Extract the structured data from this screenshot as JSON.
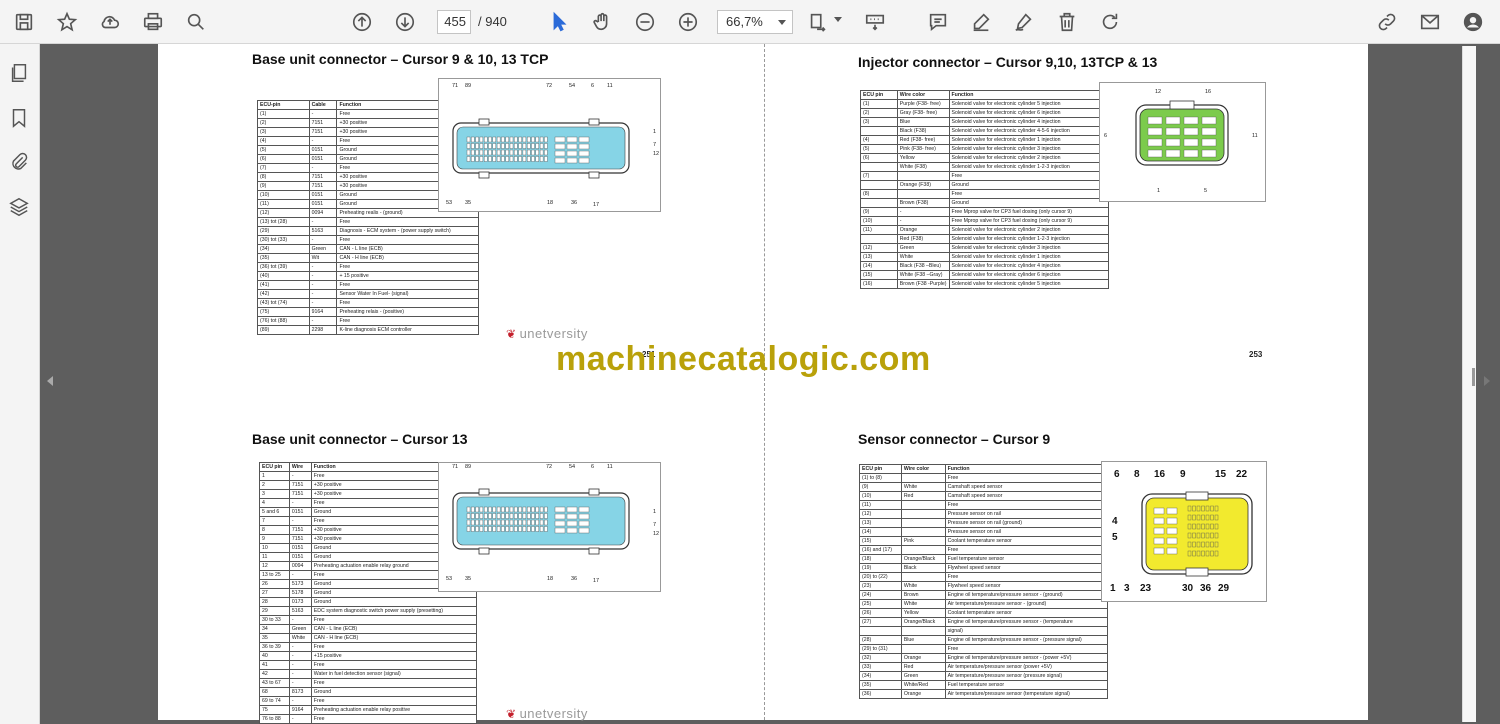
{
  "toolbar": {
    "page_current": "455",
    "page_total": "/ 940",
    "zoom": "66,7%"
  },
  "watermark": "machinecatalogic.com",
  "logo_text": "unetversity",
  "sections": {
    "base_9_10": {
      "title": "Base unit connector – Cursor 9 & 10, 13 TCP",
      "headers": [
        "ECU-pin",
        "Cable",
        "Function"
      ],
      "rows": [
        [
          "(1)",
          "-",
          "Free"
        ],
        [
          "(2)",
          "7151",
          "+30 positive"
        ],
        [
          "(3)",
          "7151",
          "+30 positive"
        ],
        [
          "(4)",
          "-",
          "Free"
        ],
        [
          "(5)",
          "0151",
          "Ground"
        ],
        [
          "(6)",
          "0151",
          "Ground"
        ],
        [
          "(7)",
          "-",
          "Free"
        ],
        [
          "(8)",
          "7151",
          "+30 positive"
        ],
        [
          "(9)",
          "7151",
          "+30 positive"
        ],
        [
          "(10)",
          "0151",
          "Ground"
        ],
        [
          "(11)",
          "0151",
          "Ground"
        ],
        [
          "(12)",
          "0094",
          "Preheating realis - (ground)"
        ],
        [
          "(13) tot (28)",
          "-",
          "Free"
        ],
        [
          "(29)",
          "5163",
          "Diagnosis - ECM system - (power supply switch)"
        ],
        [
          "(30) tot (33)",
          "-",
          "Free"
        ],
        [
          "(34)",
          "Green",
          "CAN - L line (ECB)"
        ],
        [
          "(35)",
          "Wit",
          "CAN - H line (ECB)"
        ],
        [
          "(36) tot (39)",
          "-",
          "Free"
        ],
        [
          "(40)",
          "-",
          "+ 15 positive"
        ],
        [
          "(41)",
          "-",
          "Free"
        ],
        [
          "(42)",
          "-",
          "Sensor Water In Fuel- (signal)"
        ],
        [
          "(43) tot (74)",
          "-",
          "Free"
        ],
        [
          "(75)",
          "9164",
          "Preheating relais - (positive)"
        ],
        [
          "(76) tot (88)",
          "-",
          "Free"
        ],
        [
          "(89)",
          "2298",
          "K-line diagnosis ECM controller"
        ]
      ],
      "pins_top": [
        "71",
        "89",
        "72",
        "54",
        "6",
        "11"
      ],
      "pins_right": [
        "1",
        "7",
        "12"
      ],
      "pins_bottom": [
        "53",
        "35",
        "18",
        "36",
        "17"
      ],
      "page_number": "251"
    },
    "base_13": {
      "title": "Base unit connector – Cursor 13",
      "headers": [
        "ECU pin",
        "Wire",
        "Function"
      ],
      "rows": [
        [
          "1",
          "-",
          "Free"
        ],
        [
          "2",
          "7151",
          "+30 positive"
        ],
        [
          "3",
          "7151",
          "+30 positive"
        ],
        [
          "4",
          "-",
          "Free"
        ],
        [
          "5 and 6",
          "0151",
          "Ground"
        ],
        [
          "7",
          "-",
          "Free"
        ],
        [
          "8",
          "7151",
          "+30 positive"
        ],
        [
          "9",
          "7151",
          "+30 positive"
        ],
        [
          "10",
          "0151",
          "Ground"
        ],
        [
          "11",
          "0151",
          "Ground"
        ],
        [
          "12",
          "0094",
          "Preheating actuation enable relay ground"
        ],
        [
          "13 to 25",
          "-",
          "Free"
        ],
        [
          "26",
          "5173",
          "Ground"
        ],
        [
          "27",
          "5178",
          "Ground"
        ],
        [
          "28",
          "0173",
          "Ground"
        ],
        [
          "29",
          "5163",
          "EDC system diagnostic switch power supply (presetting)"
        ],
        [
          "30 to 33",
          "-",
          "Free"
        ],
        [
          "34",
          "Green",
          "CAN - L line (ECB)"
        ],
        [
          "35",
          "White",
          "CAN - H line (ECB)"
        ],
        [
          "36 to 39",
          "-",
          "Free"
        ],
        [
          "40",
          "-",
          "+15 positive"
        ],
        [
          "41",
          "-",
          "Free"
        ],
        [
          "42",
          "-",
          "Water in fuel detection sensor (signal)"
        ],
        [
          "43 to 67",
          "-",
          "Free"
        ],
        [
          "68",
          "8173",
          "Ground"
        ],
        [
          "69 to 74",
          "-",
          "Free"
        ],
        [
          "75",
          "9164",
          "Preheating actuation enable relay positive"
        ],
        [
          "76 to 88",
          "-",
          "Free"
        ]
      ],
      "pins_top": [
        "71",
        "89",
        "72",
        "54",
        "6",
        "11"
      ],
      "pins_right": [
        "1",
        "7",
        "12"
      ],
      "pins_bottom": [
        "53",
        "35",
        "18",
        "36",
        "17"
      ]
    },
    "injector": {
      "title": "Injector connector – Cursor 9,10, 13TCP & 13",
      "headers": [
        "ECU pin",
        "Wire color",
        "Function"
      ],
      "rows": [
        [
          "(1)",
          "Purple   (F38- free)",
          "Solenoid valve for electronic cylinder 5 injection"
        ],
        [
          "(2)",
          "Gray   (F38- free)",
          "Solenoid valve for electronic cylinder 6 injection"
        ],
        [
          "(3)",
          "Blue",
          "Solenoid valve for electronic cylinder 4 injection"
        ],
        [
          "",
          "Black      (F38)",
          "Solenoid valve for electronic cylinder 4-5-6 injection"
        ],
        [
          "(4)",
          "Red   (F38- free)",
          "Solenoid valve for electronic cylinder 1 injection"
        ],
        [
          "(5)",
          "Pink   (F38- free)",
          "Solenoid valve for electronic cylinder 3 injection"
        ],
        [
          "(6)",
          "Yellow",
          "Solenoid valve for electronic cylinder 2 injection"
        ],
        [
          "",
          "White      (F38)",
          "Solenoid valve for electronic cylinder 1-2-3 injection"
        ],
        [
          "(7)",
          "",
          "Free"
        ],
        [
          "",
          "Orange    (F38)",
          "Ground"
        ],
        [
          "(8)",
          "",
          "Free"
        ],
        [
          "",
          "Brown    (F38)",
          "Ground"
        ],
        [
          "(9)",
          "-",
          "Free   Mprop valve for CP3 fuel dosing (only cursor 9)"
        ],
        [
          "(10)",
          "-",
          "Free   Mprop valve for CP3 fuel dosing (only cursor 9)"
        ],
        [
          "(11)",
          "Orange",
          "Solenoid valve for electronic cylinder 2 injection"
        ],
        [
          "",
          "Red         (F38)",
          "Solenoid valve for electronic cylinder 1-2-3 injection"
        ],
        [
          "(12)",
          "Green",
          "Solenoid valve for electronic cylinder 3 injection"
        ],
        [
          "(13)",
          "White",
          "Solenoid valve for electronic cylinder 1 injection"
        ],
        [
          "(14)",
          "Black   (F38 –Bleu)",
          "Solenoid valve for electronic cylinder 4 injection"
        ],
        [
          "(15)",
          "White  (F38 –Gray)",
          "Solenoid valve for electronic cylinder 6 injection"
        ],
        [
          "(16)",
          "Brown (F38 -Purple)",
          "Solenoid valve for electronic cylinder 5 injection"
        ]
      ],
      "pins": [
        "12",
        "16",
        "6",
        "11",
        "1",
        "5"
      ],
      "page_number": "253"
    },
    "sensor": {
      "title": "Sensor connector – Cursor 9",
      "headers": [
        "ECU pin",
        "Wire color",
        "Function"
      ],
      "rows": [
        [
          "(1) to (8)",
          "",
          "Free"
        ],
        [
          "(9)",
          "White",
          "Camshaft speed sensor"
        ],
        [
          "(10)",
          "Red",
          "Camshaft speed sensor"
        ],
        [
          "(11)",
          "",
          "Free"
        ],
        [
          "(12)",
          "",
          "Pressure sensor on rail"
        ],
        [
          "(13)",
          "",
          "Pressure sensor on rail (ground)"
        ],
        [
          "(14)",
          "",
          "Pressure sensor on rail"
        ],
        [
          "(15)",
          "Pink",
          "Coolant temperature sensor"
        ],
        [
          "(16) and (17)",
          "",
          "Free"
        ],
        [
          "(18)",
          "Orange/Black",
          "Fuel temperature sensor"
        ],
        [
          "(19)",
          "Black",
          "Flywheel speed sensor"
        ],
        [
          "(20) to (22)",
          "",
          "Free"
        ],
        [
          "(23)",
          "White",
          "Flywheel speed sensor"
        ],
        [
          "(24)",
          "Brown",
          "Engine oil temperature/pressure sensor - (ground)"
        ],
        [
          "(25)",
          "White",
          "Air temperature/pressure sensor - (ground)"
        ],
        [
          "(26)",
          "Yellow",
          "Coolant temperature sensor"
        ],
        [
          "(27)",
          "Orange/Black",
          "Engine oil temperature/pressure sensor - (temperature"
        ],
        [
          "",
          "",
          "signal)"
        ],
        [
          "(28)",
          "Blue",
          "Engine oil temperature/pressure sensor - (pressure signal)"
        ],
        [
          "(29) to (31)",
          "",
          "Free"
        ],
        [
          "(32)",
          "Orange",
          "Engine oil temperature/pressure sensor - (power  +5V)"
        ],
        [
          "(33)",
          "Red",
          "Air temperature/pressure sensor (power +5V)"
        ],
        [
          "(34)",
          "Green",
          "Air temperature/pressure sensor (pressure signal)"
        ],
        [
          "(35)",
          "White/Red",
          "Fuel temperature sensor"
        ],
        [
          "(36)",
          "Orange",
          "Air temperature/pressure sensor (temperature signal)"
        ]
      ],
      "pins_top": [
        "6",
        "8",
        "16",
        "9",
        "15",
        "22"
      ],
      "pins_left": [
        "4",
        "5"
      ],
      "pins_bottom": [
        "1",
        "3",
        "23",
        "30",
        "36",
        "29"
      ]
    }
  }
}
